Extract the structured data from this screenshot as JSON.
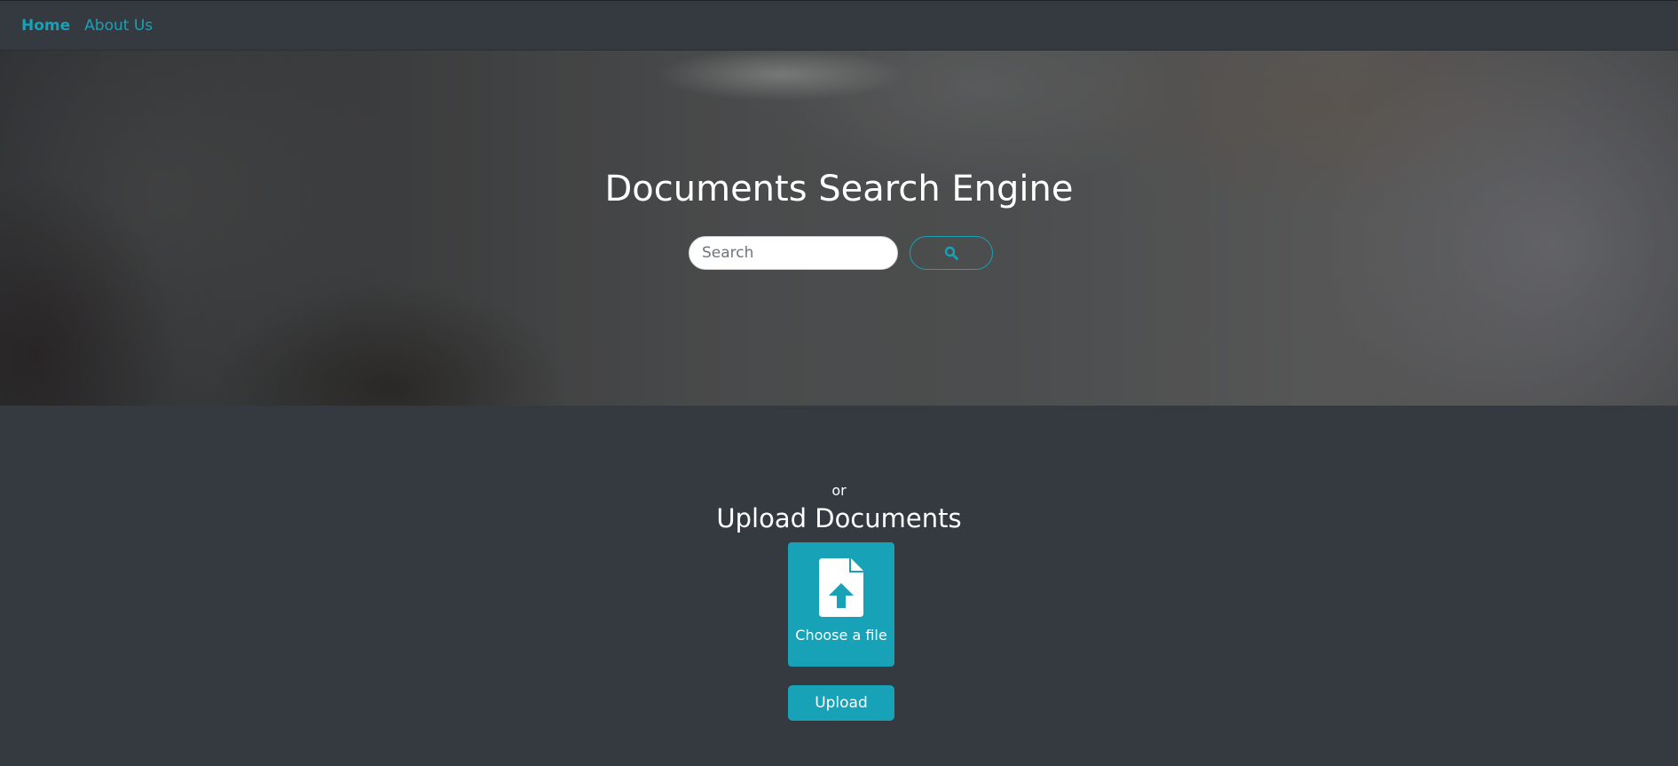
{
  "nav": {
    "items": [
      {
        "label": "Home",
        "active": true
      },
      {
        "label": "About Us",
        "active": false
      }
    ]
  },
  "hero": {
    "title": "Documents Search Engine",
    "search": {
      "placeholder": "Search",
      "value": "",
      "button_icon": "search-icon"
    }
  },
  "upload": {
    "or_text": "or",
    "title": "Upload Documents",
    "file_box": {
      "icon": "file-upload-icon",
      "label": "Choose a file"
    },
    "button_label": "Upload"
  },
  "colors": {
    "accent": "#17a2b8",
    "background": "#343a40",
    "text": "#ffffff"
  }
}
